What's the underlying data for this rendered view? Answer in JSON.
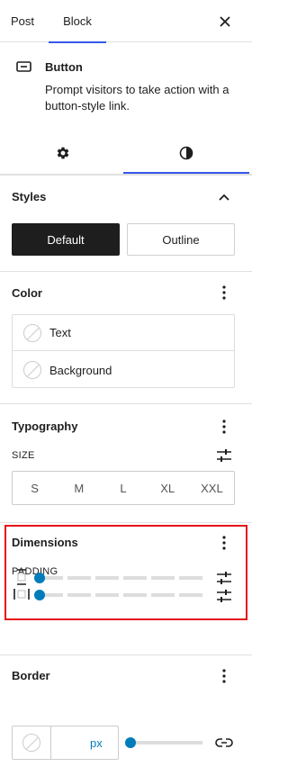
{
  "header": {
    "tabs": [
      {
        "label": "Post",
        "active": false
      },
      {
        "label": "Block",
        "active": true
      }
    ],
    "close_icon": "close-icon"
  },
  "block": {
    "icon": "button-icon",
    "title": "Button",
    "description": "Prompt visitors to take action with a button-style link."
  },
  "inspector_tabs": {
    "settings_icon": "gear-icon",
    "styles_icon": "contrast-icon",
    "active": "styles"
  },
  "styles_panel": {
    "title": "Styles",
    "options": [
      "Default",
      "Outline"
    ],
    "selected": "Default"
  },
  "color_panel": {
    "title": "Color",
    "items": [
      "Text",
      "Background"
    ]
  },
  "typography_panel": {
    "title": "Typography",
    "size_label": "SIZE",
    "sizes": [
      "S",
      "M",
      "L",
      "XL",
      "XXL"
    ]
  },
  "dimensions_panel": {
    "title": "Dimensions",
    "padding_label": "PADDING",
    "vertical_padding_value": 0,
    "horizontal_padding_value": 0
  },
  "border_panel": {
    "title": "Border",
    "unit": "px",
    "radius_value": 0
  },
  "colors": {
    "accent": "#3858e9",
    "slider": "#007cba",
    "highlight": "#e3131b"
  }
}
